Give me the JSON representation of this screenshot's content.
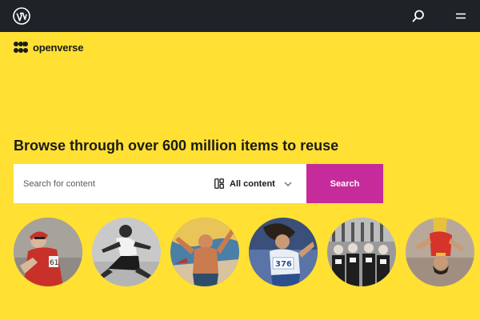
{
  "topbar": {
    "logo_icon": "wordpress-logo-icon",
    "search_icon": "search-icon",
    "menu_icon": "menu-icon",
    "background": "#1d2327"
  },
  "brand": {
    "name": "openverse",
    "mark_icon": "openverse-logo-icon"
  },
  "hero": {
    "headline": "Browse through over 600 million items to reuse",
    "background": "#ffe033"
  },
  "search": {
    "placeholder": "Search for content",
    "value": "",
    "content_type_label": "All content",
    "content_type_icon": "all-content-icon",
    "submit_label": "Search",
    "accent": "#c52b9b"
  },
  "gallery": {
    "items": [
      {
        "subject": "cyclist"
      },
      {
        "subject": "long-jumper"
      },
      {
        "subject": "illustrated-athlete"
      },
      {
        "subject": "runner-376"
      },
      {
        "subject": "team-photo"
      },
      {
        "subject": "gymnast"
      }
    ]
  }
}
